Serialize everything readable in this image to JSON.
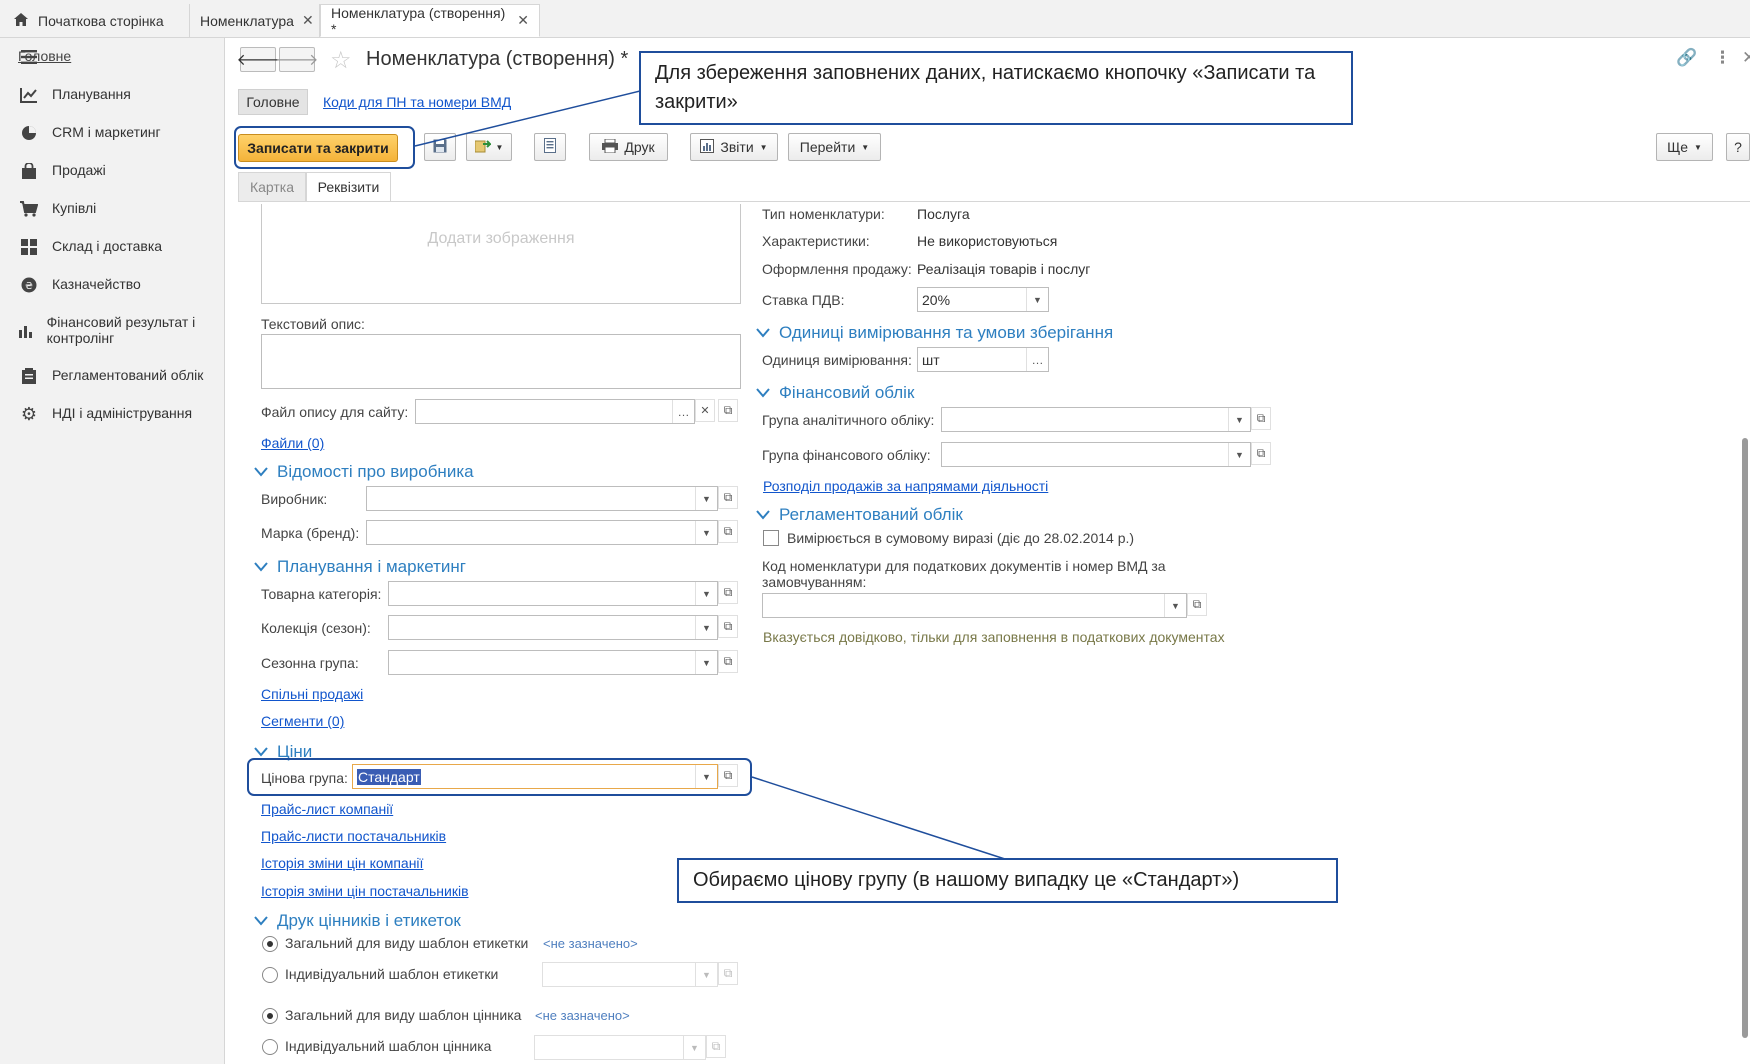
{
  "tabs": {
    "home": "Початкова сторінка",
    "nomenclature": "Номенклатура",
    "nomenclature_create": "Номенклатура (створення) *"
  },
  "sidebar": {
    "items": [
      {
        "label": "Головне",
        "icon": "menu-icon"
      },
      {
        "label": "Планування",
        "icon": "planning-icon"
      },
      {
        "label": "CRM і маркетинг",
        "icon": "pie-chart-icon"
      },
      {
        "label": "Продажі",
        "icon": "shopping-bag-icon"
      },
      {
        "label": "Купівлі",
        "icon": "cart-icon"
      },
      {
        "label": "Склад і доставка",
        "icon": "warehouse-icon"
      },
      {
        "label": "Казначейство",
        "icon": "treasury-icon"
      },
      {
        "label": "Фінансовий результат і контролінг",
        "icon": "bar-chart-icon"
      },
      {
        "label": "Регламентований облік",
        "icon": "register-icon"
      },
      {
        "label": "НДІ і адміністрування",
        "icon": "gear-icon"
      }
    ]
  },
  "header": {
    "title": "Номенклатура (створення) *",
    "tab_main": "Головне",
    "tab_codes": "Коди для ПН та номери ВМД"
  },
  "toolbar": {
    "save_close": "Записати та закрити",
    "print": "Друк",
    "reports": "Звіти",
    "goto": "Перейти",
    "more": "Ще",
    "help": "?"
  },
  "content_tabs": {
    "card": "Картка",
    "details": "Реквізити"
  },
  "left": {
    "add_image": "Додати зображення",
    "text_desc_label": "Текстовий опис:",
    "site_file_label": "Файл опису для сайту:",
    "files_link": "Файли (0)",
    "section_manufacturer": "Відомості про виробника",
    "manufacturer_label": "Виробник:",
    "brand_label": "Марка (бренд):",
    "section_planning": "Планування і маркетинг",
    "category_label": "Товарна категорія:",
    "collection_label": "Колекція (сезон):",
    "season_group_label": "Сезонна група:",
    "joint_sales_link": "Спільні продажі",
    "segments_link": "Сегменти (0)",
    "section_prices": "Ціни",
    "price_group_label": "Цінова група:",
    "price_group_value": "Стандарт",
    "price_list_link": "Прайс-лист компанії",
    "supplier_lists_link": "Прайс-листи постачальників",
    "price_history_link": "Історія зміни цін компанії",
    "supplier_history_link": "Історія зміни цін постачальників",
    "section_labels": "Друк цінників і етикеток",
    "common_label_template": "Загальний для виду шаблон етикетки",
    "common_label_value": "<не зазначено>",
    "individual_label_template": "Індивідуальний шаблон етикетки",
    "common_tag_template": "Загальний для виду шаблон цінника",
    "common_tag_value": "<не зазначено>",
    "individual_tag_template": "Індивідуальний шаблон цінника"
  },
  "right": {
    "type_label": "Тип номенклатури:",
    "type_value": "Послуга",
    "chars_label": "Характеристики:",
    "chars_value": "Не використовуються",
    "sale_label": "Оформлення продажу:",
    "sale_value": "Реалізація товарів і послуг",
    "vat_label": "Ставка ПДВ:",
    "vat_value": "20%",
    "section_units": "Одиниці вимірювання та умови зберігання",
    "unit_label": "Одиниця вимірювання:",
    "unit_value": "шт",
    "section_finance": "Фінансовий облік",
    "analytic_group_label": "Група аналітичного обліку:",
    "finance_group_label": "Група фінансового обліку:",
    "distribution_link": "Розподіл продажів за напрямами діяльності",
    "section_reg": "Регламентований облік",
    "sum_checkbox": "Вимірюється в сумовому виразі (діє до 28.02.2014 р.)",
    "code_label": "Код номенклатури для податкових документів і номер ВМД за замовчуванням:",
    "code_hint": "Вказується довідково, тільки для заповнення в податкових документах"
  },
  "callouts": {
    "save": "Для збереження заповнених даних, натискаємо кнопочку «Записати та закрити»",
    "price": "Обираємо цінову групу (в нашому випадку це «Стандарт»)"
  },
  "colors": {
    "accent": "#2e7fc0",
    "primary_button": "#f4b33a",
    "callout_border": "#1f4e9c"
  }
}
